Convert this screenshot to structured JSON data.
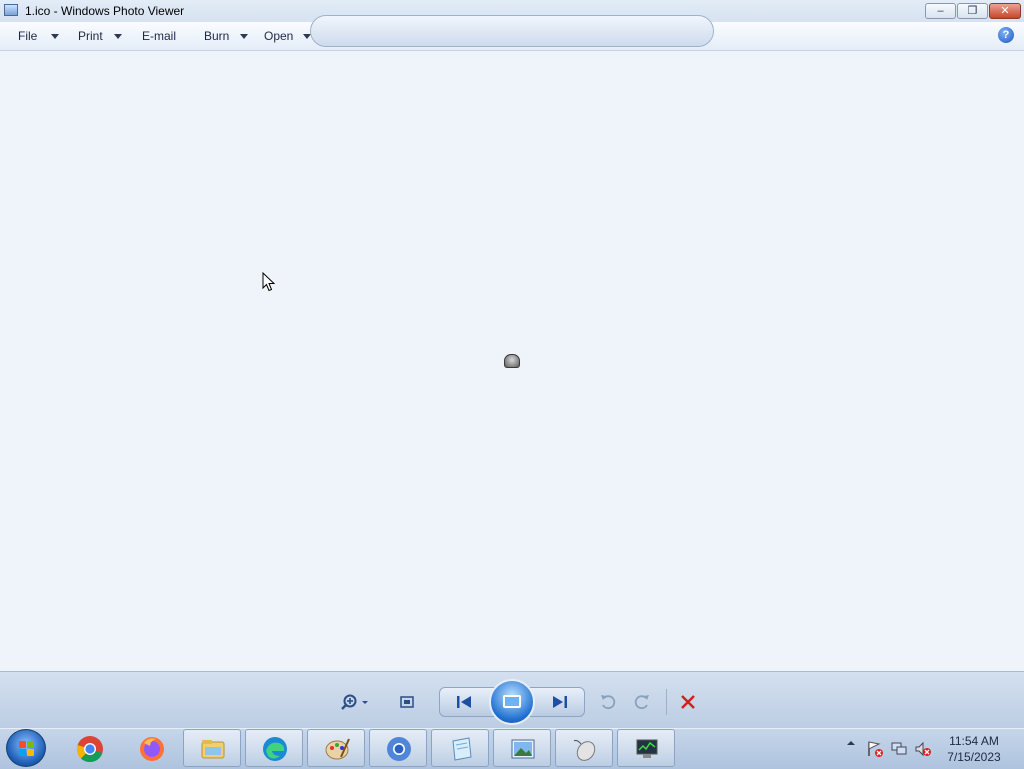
{
  "window": {
    "title": "1.ico - Windows Photo Viewer",
    "controls": {
      "minimize": "–",
      "restore": "❐",
      "close": "✕"
    }
  },
  "menu": {
    "items": [
      {
        "label": "File",
        "has_dropdown": true
      },
      {
        "label": "Print",
        "has_dropdown": true
      },
      {
        "label": "E-mail",
        "has_dropdown": false
      },
      {
        "label": "Burn",
        "has_dropdown": true
      },
      {
        "label": "Open",
        "has_dropdown": true
      }
    ],
    "help": "?"
  },
  "controls": {
    "zoom": "zoom-icon",
    "actual_size": "actual-size-icon",
    "previous": "previous-icon",
    "slideshow": "slideshow-icon",
    "next": "next-icon",
    "rotate_ccw": "rotate-counterclockwise-icon",
    "rotate_cw": "rotate-clockwise-icon",
    "delete": "delete-icon"
  },
  "taskbar": {
    "apps": [
      {
        "name": "chrome",
        "running": false
      },
      {
        "name": "firefox",
        "running": false
      },
      {
        "name": "file-explorer",
        "running": true
      },
      {
        "name": "edge",
        "running": true
      },
      {
        "name": "paint",
        "running": true
      },
      {
        "name": "chromium",
        "running": true
      },
      {
        "name": "notepad",
        "running": true
      },
      {
        "name": "photo-viewer",
        "running": true
      },
      {
        "name": "mouse-properties",
        "running": true
      },
      {
        "name": "network-monitor",
        "running": true
      }
    ],
    "clock": {
      "time": "11:54 AM",
      "date": "7/15/2023"
    }
  },
  "colors": {
    "accent": "#1f6fd0",
    "delete": "#d0201a",
    "close": "#c7452a"
  }
}
